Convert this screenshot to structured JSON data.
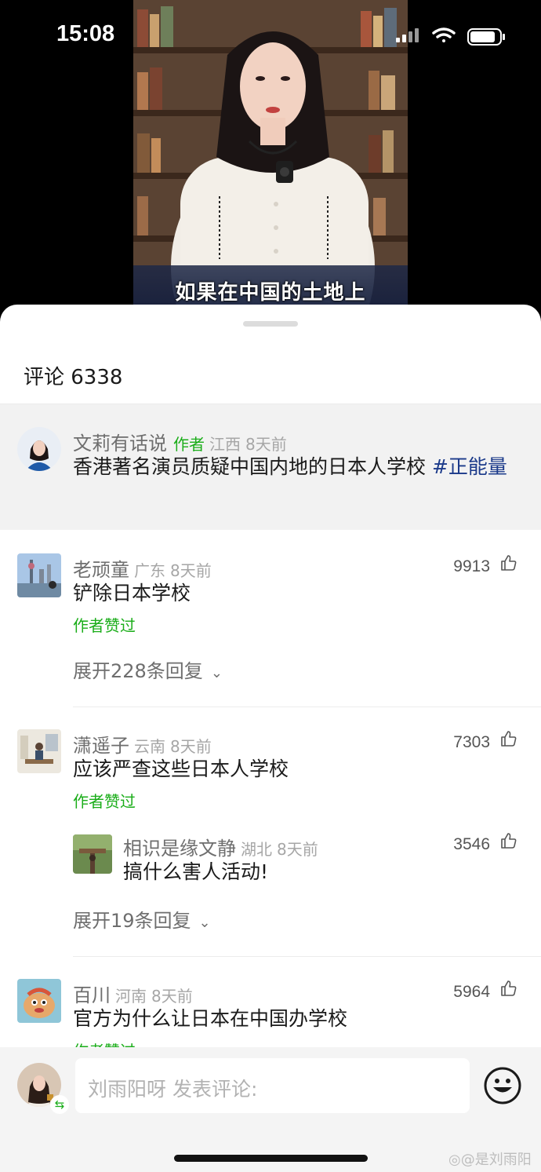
{
  "status_bar": {
    "time": "15:08"
  },
  "video": {
    "subtitle": "如果在中国的土地上"
  },
  "comments_panel": {
    "title": "评论 6338"
  },
  "pinned_post": {
    "author": "文莉有话说",
    "author_badge": "作者",
    "location": "江西",
    "time": "8天前",
    "text": "香港著名演员质疑中国内地的日本人学校 ",
    "hashtag": "#正能量"
  },
  "comments": [
    {
      "author": "老顽童",
      "location": "广东",
      "time": "8天前",
      "likes": "9913",
      "text": "铲除日本学校",
      "author_liked": "作者赞过",
      "expand_label": "展开228条回复"
    },
    {
      "author": "潇遥子",
      "location": "云南",
      "time": "8天前",
      "likes": "7303",
      "text": "应该严查这些日本人学校",
      "author_liked": "作者赞过",
      "reply": {
        "author": "相识是缘文静",
        "location": "湖北",
        "time": "8天前",
        "likes": "3546",
        "text": "搞什么害人活动!"
      },
      "expand_label": "展开19条回复"
    },
    {
      "author": "百川",
      "location": "河南",
      "time": "8天前",
      "likes": "5964",
      "text": "官方为什么让日本在中国办学校",
      "author_liked": "作者赞过"
    }
  ],
  "composer": {
    "placeholder": "刘雨阳呀 发表评论:"
  },
  "watermark": "@是刘雨阳",
  "colors": {
    "accent_green": "#1aad19",
    "hashtag_blue": "#1b3a8a",
    "background": "#ffffff"
  }
}
